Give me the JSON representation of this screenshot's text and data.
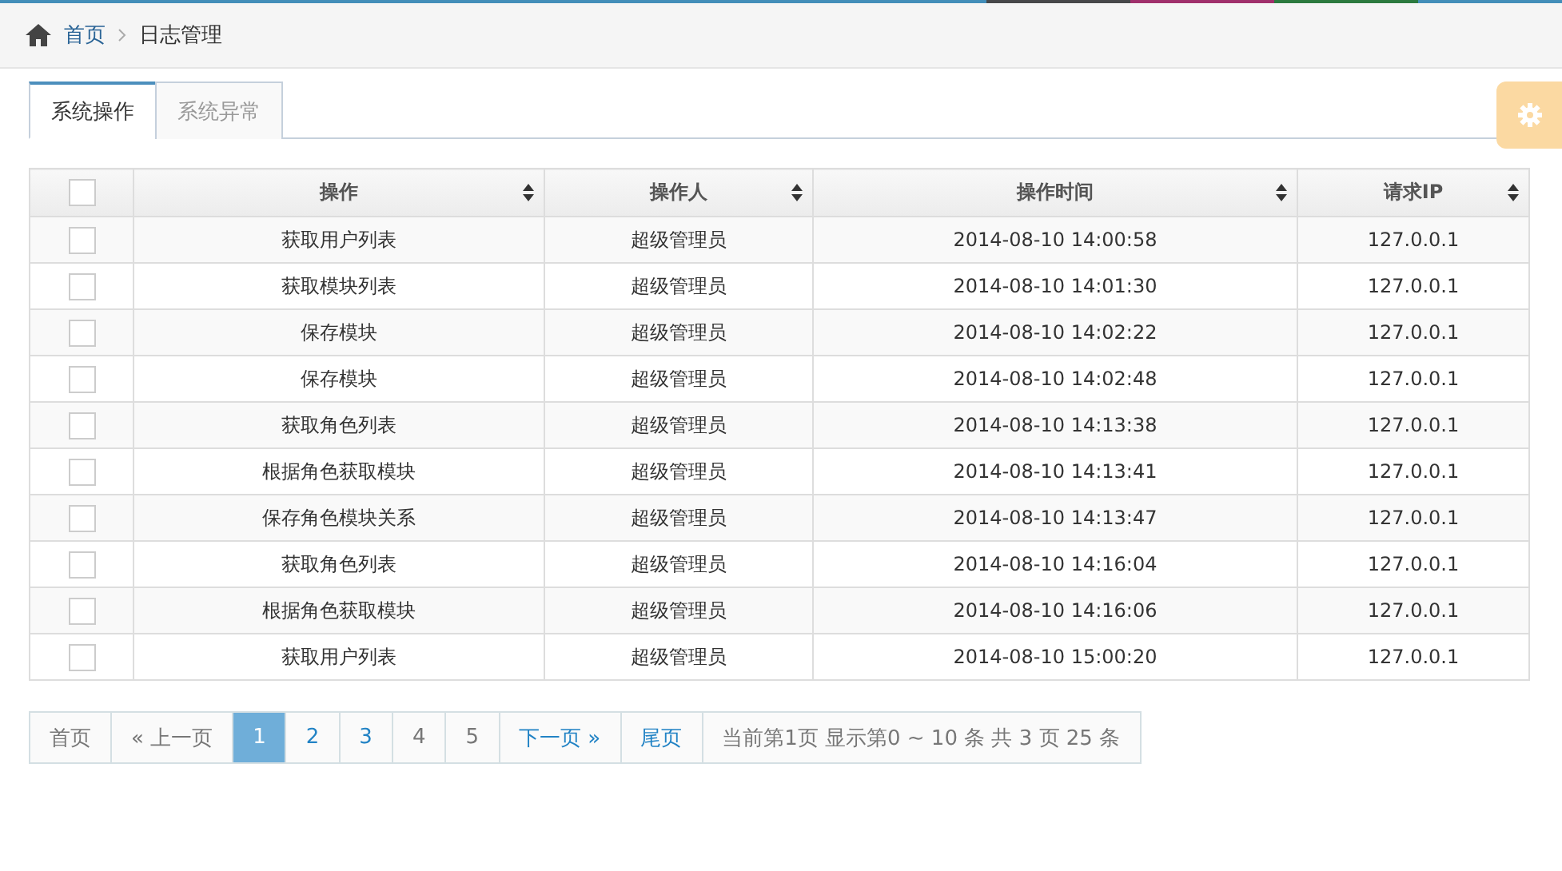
{
  "breadcrumb": [
    {
      "label": "首页",
      "link": true
    },
    {
      "label": "日志管理",
      "link": false
    }
  ],
  "tabs": [
    {
      "label": "系统操作",
      "selected": true
    },
    {
      "label": "系统异常",
      "selected": false
    }
  ],
  "table": {
    "all_checked": false,
    "columns": [
      "操作",
      "操作人",
      "操作时间",
      "请求IP"
    ],
    "rows": [
      {
        "checked": false,
        "cells": [
          "获取用户列表",
          "超级管理员",
          "2014-08-10 14:00:58",
          "127.0.0.1"
        ]
      },
      {
        "checked": false,
        "cells": [
          "获取模块列表",
          "超级管理员",
          "2014-08-10 14:01:30",
          "127.0.0.1"
        ]
      },
      {
        "checked": false,
        "cells": [
          "保存模块",
          "超级管理员",
          "2014-08-10 14:02:22",
          "127.0.0.1"
        ]
      },
      {
        "checked": false,
        "cells": [
          "保存模块",
          "超级管理员",
          "2014-08-10 14:02:48",
          "127.0.0.1"
        ]
      },
      {
        "checked": false,
        "cells": [
          "获取角色列表",
          "超级管理员",
          "2014-08-10 14:13:38",
          "127.0.0.1"
        ]
      },
      {
        "checked": false,
        "cells": [
          "根据角色获取模块",
          "超级管理员",
          "2014-08-10 14:13:41",
          "127.0.0.1"
        ]
      },
      {
        "checked": false,
        "cells": [
          "保存角色模块关系",
          "超级管理员",
          "2014-08-10 14:13:47",
          "127.0.0.1"
        ]
      },
      {
        "checked": false,
        "cells": [
          "获取角色列表",
          "超级管理员",
          "2014-08-10 14:16:04",
          "127.0.0.1"
        ]
      },
      {
        "checked": false,
        "cells": [
          "根据角色获取模块",
          "超级管理员",
          "2014-08-10 14:16:06",
          "127.0.0.1"
        ]
      },
      {
        "checked": false,
        "cells": [
          "获取用户列表",
          "超级管理员",
          "2014-08-10 15:00:20",
          "127.0.0.1"
        ]
      }
    ]
  },
  "pagination": {
    "items": [
      {
        "label": "首页",
        "selected": false,
        "disabled": true
      },
      {
        "label": "« 上一页",
        "selected": false,
        "disabled": true
      },
      {
        "label": "1",
        "selected": true,
        "disabled": false
      },
      {
        "label": "2",
        "selected": false,
        "disabled": false
      },
      {
        "label": "3",
        "selected": false,
        "disabled": false
      },
      {
        "label": "4",
        "selected": false,
        "disabled": true
      },
      {
        "label": "5",
        "selected": false,
        "disabled": true
      },
      {
        "label": "下一页 »",
        "selected": false,
        "disabled": false
      },
      {
        "label": "尾页",
        "selected": false,
        "disabled": false
      }
    ],
    "info": "当前第1页 显示第0 ~ 10 条 共 3 页 25 条"
  }
}
